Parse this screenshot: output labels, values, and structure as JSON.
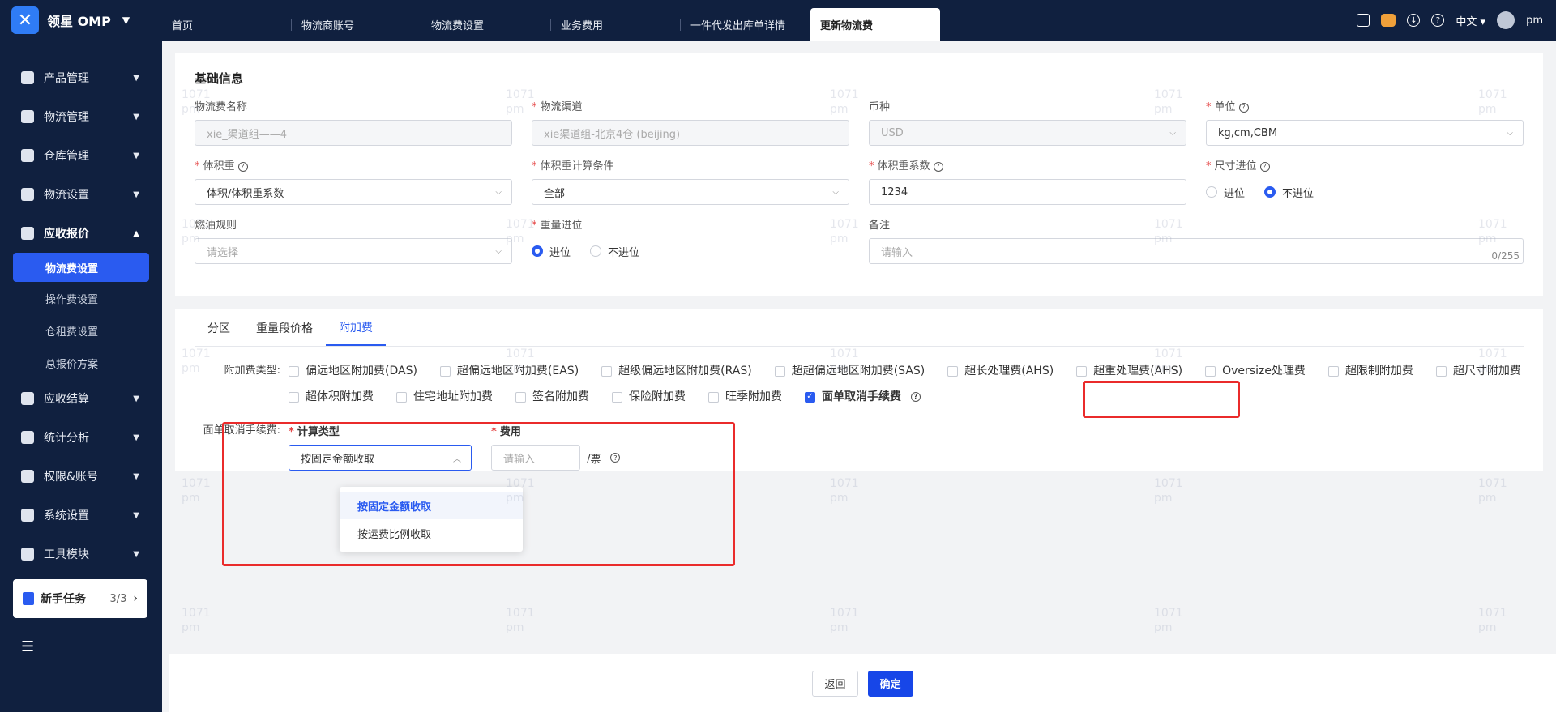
{
  "app": {
    "name": "领星 OMP"
  },
  "tabs": [
    {
      "label": "首页"
    },
    {
      "label": "物流商账号"
    },
    {
      "label": "物流费设置"
    },
    {
      "label": "业务费用"
    },
    {
      "label": "一件代发出库单详情"
    },
    {
      "label": "更新物流费"
    }
  ],
  "topright": {
    "lang": "中文",
    "user": "pm"
  },
  "sidebar": {
    "items": [
      {
        "label": "产品管理"
      },
      {
        "label": "物流管理"
      },
      {
        "label": "仓库管理"
      },
      {
        "label": "物流设置"
      },
      {
        "label": "应收报价"
      }
    ],
    "subitems": [
      {
        "label": "物流费设置"
      },
      {
        "label": "操作费设置"
      },
      {
        "label": "仓租费设置"
      },
      {
        "label": "总报价方案"
      }
    ],
    "items2": [
      {
        "label": "应收结算"
      },
      {
        "label": "统计分析"
      },
      {
        "label": "权限&账号"
      },
      {
        "label": "系统设置"
      },
      {
        "label": "工具模块"
      }
    ],
    "task": {
      "label": "新手任务",
      "count": "3/3"
    }
  },
  "basic": {
    "title": "基础信息",
    "name_label": "物流费名称",
    "name_value": "xie_渠道组——4",
    "channel_label": "物流渠道",
    "channel_value": "xie渠道组-北京4仓 (beijing)",
    "currency_label": "币种",
    "currency_value": "USD",
    "unit_label": "单位",
    "unit_value": "kg,cm,CBM",
    "volw_label": "体积重",
    "volw_value": "体积/体积重系数",
    "volcond_label": "体积重计算条件",
    "volcond_value": "全部",
    "volcoef_label": "体积重系数",
    "volcoef_value": "1234",
    "sizeround_label": "尺寸进位",
    "size_opt1": "进位",
    "size_opt2": "不进位",
    "fuel_label": "燃油规则",
    "fuel_placeholder": "请选择",
    "weightround_label": "重量进位",
    "weight_opt1": "进位",
    "weight_opt2": "不进位",
    "remark_label": "备注",
    "remark_placeholder": "请输入",
    "remark_count": "0/255"
  },
  "subtabs": [
    {
      "label": "分区"
    },
    {
      "label": "重量段价格"
    },
    {
      "label": "附加费"
    }
  ],
  "surcharge": {
    "label": "附加费类型:",
    "types": [
      {
        "label": "偏远地区附加费(DAS)",
        "checked": false
      },
      {
        "label": "超偏远地区附加费(EAS)",
        "checked": false
      },
      {
        "label": "超级偏远地区附加费(RAS)",
        "checked": false
      },
      {
        "label": "超超偏远地区附加费(SAS)",
        "checked": false
      },
      {
        "label": "超长处理费(AHS)",
        "checked": false
      },
      {
        "label": "超重处理费(AHS)",
        "checked": false
      },
      {
        "label": "Oversize处理费",
        "checked": false
      },
      {
        "label": "超限制附加费",
        "checked": false
      },
      {
        "label": "超尺寸附加费",
        "checked": false
      },
      {
        "label": "超体积附加费",
        "checked": false
      },
      {
        "label": "住宅地址附加费",
        "checked": false
      },
      {
        "label": "签名附加费",
        "checked": false
      },
      {
        "label": "保险附加费",
        "checked": false
      },
      {
        "label": "旺季附加费",
        "checked": false
      },
      {
        "label": "面单取消手续费",
        "checked": true
      }
    ]
  },
  "fee": {
    "row_label": "面单取消手续费:",
    "calc_label": "计算类型",
    "calc_value": "按固定金额收取",
    "fee_label": "费用",
    "fee_placeholder": "请输入",
    "unit": "/票",
    "options": [
      {
        "label": "按固定金额收取"
      },
      {
        "label": "按运费比例收取"
      }
    ]
  },
  "footer": {
    "back": "返回",
    "confirm": "确定"
  },
  "watermark": {
    "line1": "1071",
    "line2": "pm"
  }
}
